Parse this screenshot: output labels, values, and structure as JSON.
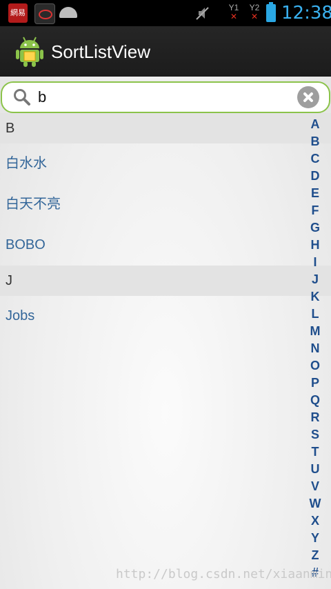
{
  "status_bar": {
    "app_icons": [
      "netease-news-app-icon",
      "wo-app-icon",
      "android-notification-icon"
    ],
    "app_163_label": "網易",
    "sim1": "1",
    "sim2": "2",
    "clock": "12:38",
    "battery_color": "#2aa7e3"
  },
  "action_bar": {
    "title": "SortListView",
    "icon": "android-robot-icon"
  },
  "search": {
    "value": "b",
    "accent": "#8bc34a"
  },
  "list": {
    "section_b": "B",
    "item_1": "白水水",
    "item_2": "白天不亮",
    "item_3": "BOBO",
    "section_j": "J",
    "item_4": "Jobs"
  },
  "index": [
    "A",
    "B",
    "C",
    "D",
    "E",
    "F",
    "G",
    "H",
    "I",
    "J",
    "K",
    "L",
    "M",
    "N",
    "O",
    "P",
    "Q",
    "R",
    "S",
    "T",
    "U",
    "V",
    "W",
    "X",
    "Y",
    "Z",
    "#"
  ],
  "watermark": "http://blog.csdn.net/xiaanming"
}
